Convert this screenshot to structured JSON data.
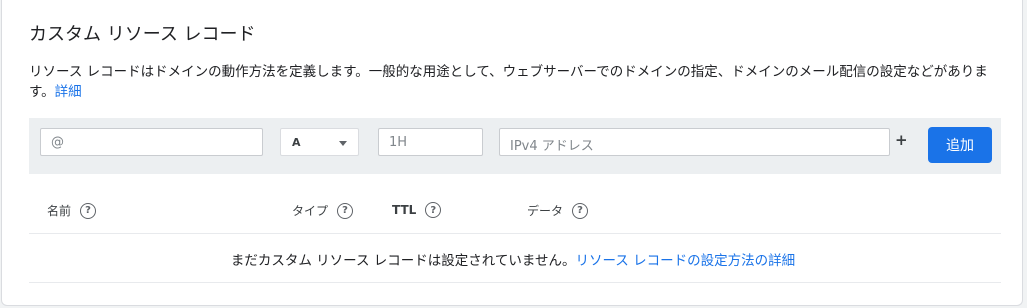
{
  "section": {
    "title": "カスタム リソース レコード",
    "description": "リソース レコードはドメインの動作方法を定義します。一般的な用途として、ウェブサーバーでのドメインの指定、ドメインのメール配信の設定などがあります。",
    "details_link": "詳細"
  },
  "form": {
    "name_placeholder": "@",
    "type_value": "A",
    "ttl_placeholder": "1H",
    "data_placeholder": "IPv4 アドレス",
    "plus_label": "+",
    "add_button": "追加"
  },
  "table": {
    "headers": {
      "name": "名前",
      "type": "タイプ",
      "ttl": "TTL",
      "data": "データ"
    },
    "help_glyph": "?",
    "empty_text": "まだカスタム リソース レコードは設定されていません。",
    "empty_link": "リソース レコードの設定方法の詳細"
  },
  "colors": {
    "accent": "#1a73e8",
    "toolbar_bg": "#eceff1"
  },
  "icons": {
    "help": "help-circle-icon",
    "dropdown": "chevron-down-icon"
  }
}
